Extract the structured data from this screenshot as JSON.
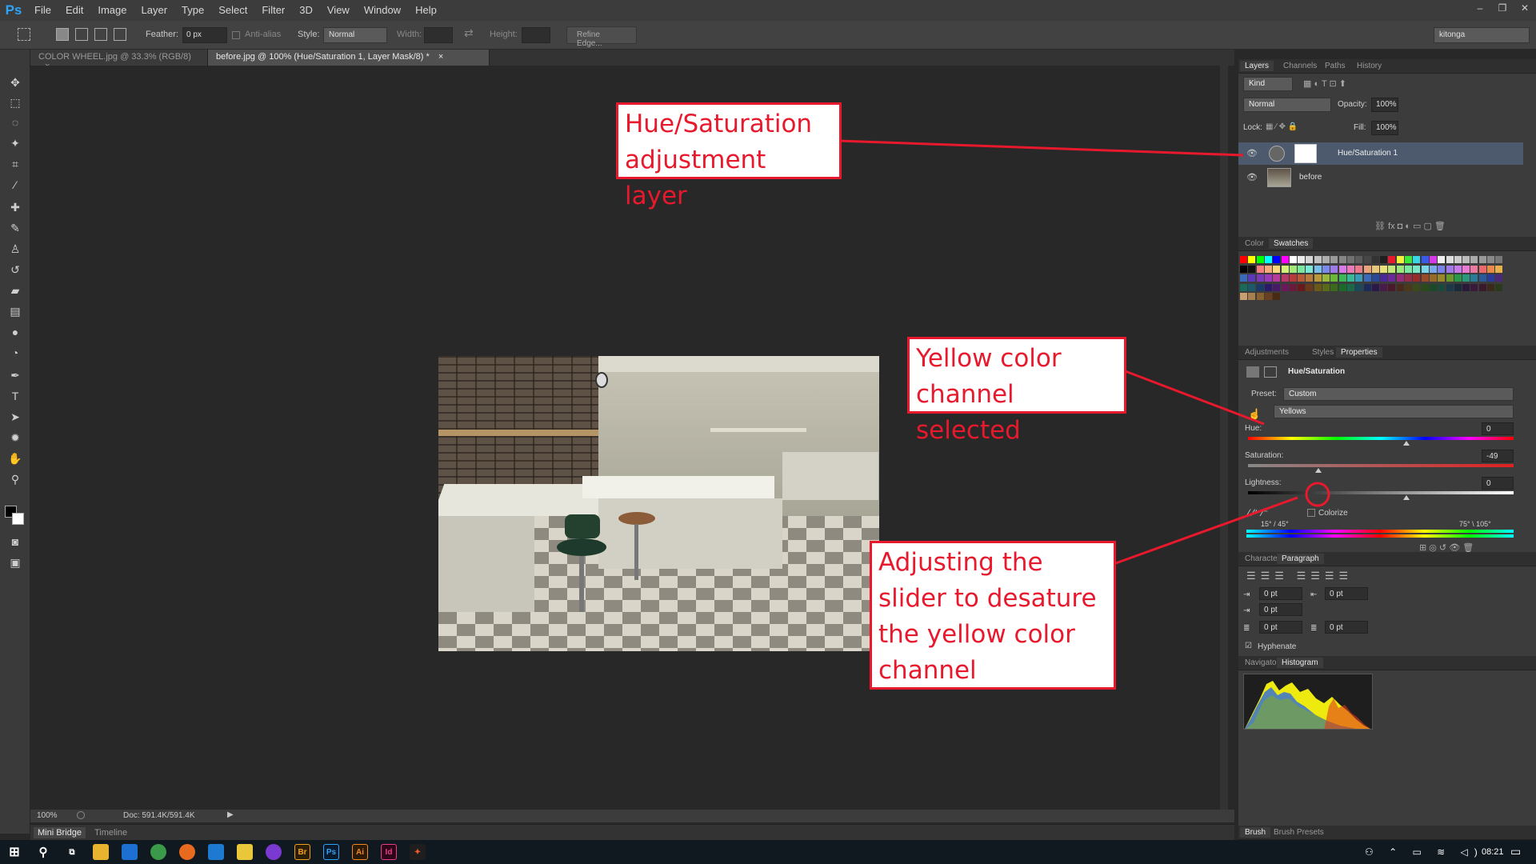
{
  "app": {
    "logo": "Ps"
  },
  "menu": [
    "File",
    "Edit",
    "Image",
    "Layer",
    "Type",
    "Select",
    "Filter",
    "3D",
    "View",
    "Window",
    "Help"
  ],
  "window_controls": [
    "–",
    "❐",
    "✕"
  ],
  "options": {
    "feather_label": "Feather:",
    "feather_value": "0 px",
    "antialias_label": "Anti-alias",
    "style_label": "Style:",
    "style_value": "Normal",
    "width_label": "Width:",
    "height_label": "Height:",
    "refine_edge": "Refine Edge...",
    "workspace": "kitonga"
  },
  "tabs": [
    {
      "label": "COLOR WHEEL.jpg @ 33.3% (RGB/8)",
      "close": "×"
    },
    {
      "label": "before.jpg @ 100% (Hue/Saturation 1, Layer Mask/8) *",
      "close": "×"
    }
  ],
  "status": {
    "zoom": "100%",
    "doc": "Doc: 591.4K/591.4K"
  },
  "bottom_tabs": [
    "Mini Bridge",
    "Timeline"
  ],
  "layers_panel": {
    "tabs": [
      "Layers",
      "Channels",
      "Paths",
      "History"
    ],
    "kind": "Kind",
    "blend_mode": "Normal",
    "opacity_label": "Opacity:",
    "opacity_value": "100%",
    "lock_label": "Lock:",
    "fill_label": "Fill:",
    "fill_value": "100%",
    "layers": [
      {
        "name": "Hue/Saturation 1",
        "selected": true
      },
      {
        "name": "before",
        "selected": false
      }
    ]
  },
  "color_panel": {
    "tabs": [
      "Color",
      "Swatches"
    ]
  },
  "properties_panel": {
    "tabs": [
      "Adjustments",
      "Styles",
      "Properties"
    ],
    "title": "Hue/Saturation",
    "preset_label": "Preset:",
    "preset_value": "Custom",
    "channel_value": "Yellows",
    "hue_label": "Hue:",
    "hue_value": "0",
    "saturation_label": "Saturation:",
    "saturation_value": "-49",
    "lightness_label": "Lightness:",
    "lightness_value": "0",
    "colorize_label": "Colorize",
    "range_left": "15° / 45°",
    "range_right": "75° \\ 105°"
  },
  "paragraph_panel": {
    "tabs": [
      "Character",
      "Paragraph"
    ],
    "fields": [
      "0 pt",
      "0 pt",
      "0 pt",
      "0 pt",
      "0 pt"
    ],
    "hyphenate": "Hyphenate"
  },
  "histogram_panel": {
    "tabs": [
      "Navigator",
      "Histogram"
    ]
  },
  "brush_tabs": [
    "Brush",
    "Brush Presets"
  ],
  "taskbar": {
    "time": "08:21"
  },
  "annotations": {
    "a1": "Hue/Saturation adjustment layer",
    "a2": "Yellow color channel selected",
    "a3": "Adjusting the slider to desature the yellow color channel"
  },
  "colors": {
    "annotation": "#e8192c",
    "selected_layer": "#4d5a6e",
    "ps_blue": "#2fa3f5"
  }
}
